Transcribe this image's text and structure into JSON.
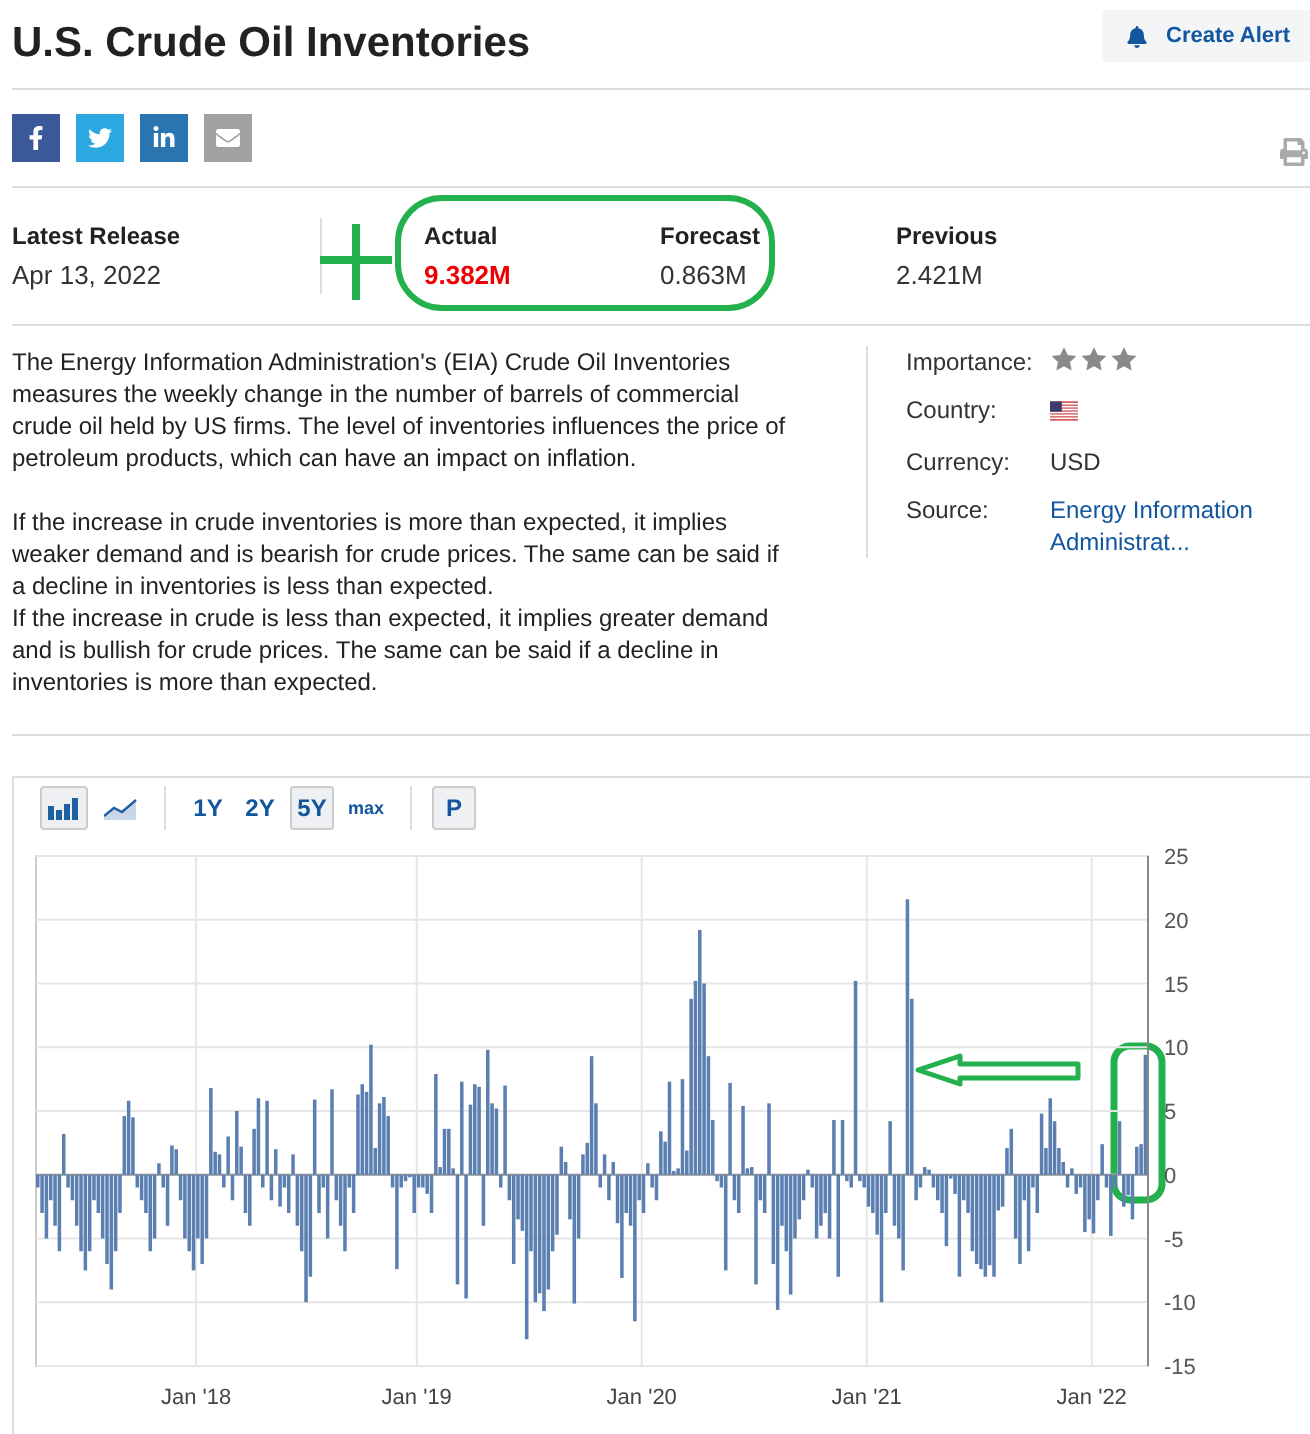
{
  "title": "U.S. Crude Oil Inventories",
  "create_alert": "Create Alert",
  "release": {
    "latest_label": "Latest Release",
    "latest_date": "Apr 13, 2022",
    "columns": [
      {
        "label": "Actual",
        "value": "9.382M",
        "kind": "actual"
      },
      {
        "label": "Forecast",
        "value": "0.863M",
        "kind": "plain"
      },
      {
        "label": "Previous",
        "value": "2.421M",
        "kind": "plain"
      }
    ]
  },
  "description": [
    "The Energy Information Administration's (EIA) Crude Oil Inventories measures the weekly change in the number of barrels of commercial crude oil held by US firms. The level of inventories influences the price of petroleum products, which can have an impact on inflation.",
    "If the increase in crude inventories is more than expected, it implies weaker demand and is bearish for crude prices. The same can be said if a decline in inventories is less than expected.",
    "If the increase in crude is less than expected, it implies greater demand and is bullish for crude prices. The same can be said if a decline in inventories is more than expected."
  ],
  "details": [
    {
      "label": "Importance:",
      "kind": "stars",
      "stars": 3
    },
    {
      "label": "Country:",
      "kind": "flag"
    },
    {
      "label": "Currency:",
      "kind": "text",
      "value": "USD"
    },
    {
      "label": "Source:",
      "kind": "link",
      "value": "Energy Information Administrat..."
    }
  ],
  "chart_toolbar": {
    "chart_types": [
      {
        "kind": "bar",
        "selected": true
      },
      {
        "kind": "line",
        "selected": false
      }
    ],
    "periods": [
      {
        "label": "1Y",
        "selected": false,
        "kind": "big"
      },
      {
        "label": "2Y",
        "selected": false,
        "kind": "big"
      },
      {
        "label": "5Y",
        "selected": true,
        "kind": "big"
      },
      {
        "label": "max",
        "selected": false,
        "kind": "small"
      }
    ],
    "p_button": "P"
  },
  "chart": {
    "x_labels": [
      "Jan '18",
      "Jan '19",
      "Jan '20",
      "Jan '21",
      "Jan '22"
    ],
    "chart_data": {
      "type": "bar",
      "grid": true,
      "ylim": [
        -15,
        25
      ],
      "yticks": [
        -15,
        -10,
        -5,
        0,
        5,
        10,
        15,
        20,
        25
      ],
      "series": [
        {
          "color": "#5b7fb0",
          "values": [
            -1,
            -3,
            -5,
            -2,
            -4,
            -6,
            3.2,
            -1,
            -2,
            -4,
            -6,
            -7.5,
            -6,
            -2,
            -3,
            -5,
            -7,
            -9,
            -6,
            -3,
            4.6,
            5.8,
            4.5,
            -1,
            -2,
            -3,
            -6,
            -5,
            0.9,
            -1,
            -4,
            2.3,
            2,
            -2,
            -5,
            -6,
            -7.5,
            -5,
            -7,
            -5,
            6.8,
            1.8,
            1.6,
            -1,
            3,
            -2,
            5,
            2.2,
            -3,
            -4,
            3.6,
            6,
            -1,
            5.8,
            -2,
            2,
            -2.5,
            -1,
            -3,
            1.6,
            -4,
            -6,
            -10,
            -8,
            5.9,
            -3,
            -1,
            -5,
            6.7,
            -2,
            -4,
            -6,
            -1,
            -3,
            6.3,
            7.1,
            6.5,
            10.2,
            2.1,
            5.6,
            6.1,
            4.6,
            -1,
            -7.4,
            -1,
            -0.5,
            -0.2,
            -3,
            -1,
            -1,
            -1.5,
            -3,
            7.9,
            0.6,
            3.6,
            3.6,
            0.5,
            -8.6,
            7.3,
            -9.7,
            5.5,
            7.1,
            6.9,
            -4,
            9.8,
            5.6,
            5.2,
            -1,
            7,
            -2,
            -7,
            -3.5,
            -4.4,
            -12.9,
            -6,
            -10,
            -9.3,
            -10.7,
            -9,
            -6,
            -4.7,
            2.2,
            1,
            -3.5,
            -10.1,
            -5,
            1.6,
            2.5,
            9.3,
            5.6,
            -1,
            1.6,
            -2,
            1,
            -3.8,
            -8.1,
            -3,
            -4,
            -11.5,
            -2,
            -3,
            0.9,
            -1,
            -2,
            3.4,
            2.6,
            7.3,
            0.3,
            0.5,
            7.5,
            1.9,
            13.8,
            15.2,
            19.2,
            15,
            9.3,
            4.3,
            -0.5,
            -1,
            -7.5,
            7.2,
            -2,
            -3,
            5.4,
            0.5,
            0.6,
            -8.6,
            -2,
            -3,
            5.6,
            -7,
            -10.6,
            -4,
            -6,
            -9.4,
            -5,
            -3.5,
            -2,
            0.4,
            -1,
            -5,
            -4,
            -3,
            -5,
            4.3,
            -8,
            4.3,
            -0.5,
            -1,
            15.2,
            -0.5,
            -1,
            -2.5,
            -3,
            -4.7,
            -10,
            -3,
            4.2,
            -4,
            -5,
            -7.5,
            21.6,
            13.8,
            -2,
            -1,
            0.6,
            0.4,
            -1,
            -2,
            -3,
            -5.6,
            -0.3,
            -1.5,
            -8,
            -2,
            -3,
            -6,
            -7,
            -7.4,
            -8,
            -7.1,
            -8,
            -2.8,
            -2.5,
            2.1,
            3.6,
            -5,
            -7,
            -2,
            -6,
            -1,
            -3,
            4.8,
            2.1,
            6,
            4.2,
            2.1,
            1,
            -1,
            0.5,
            -1.5,
            -1,
            -4.5,
            -3.5,
            -4.6,
            -2,
            2.4,
            -1,
            -4.8,
            -1,
            4.2,
            -2.5,
            -1.6,
            -3.5,
            2.2,
            2.4,
            9.4
          ]
        }
      ]
    }
  }
}
